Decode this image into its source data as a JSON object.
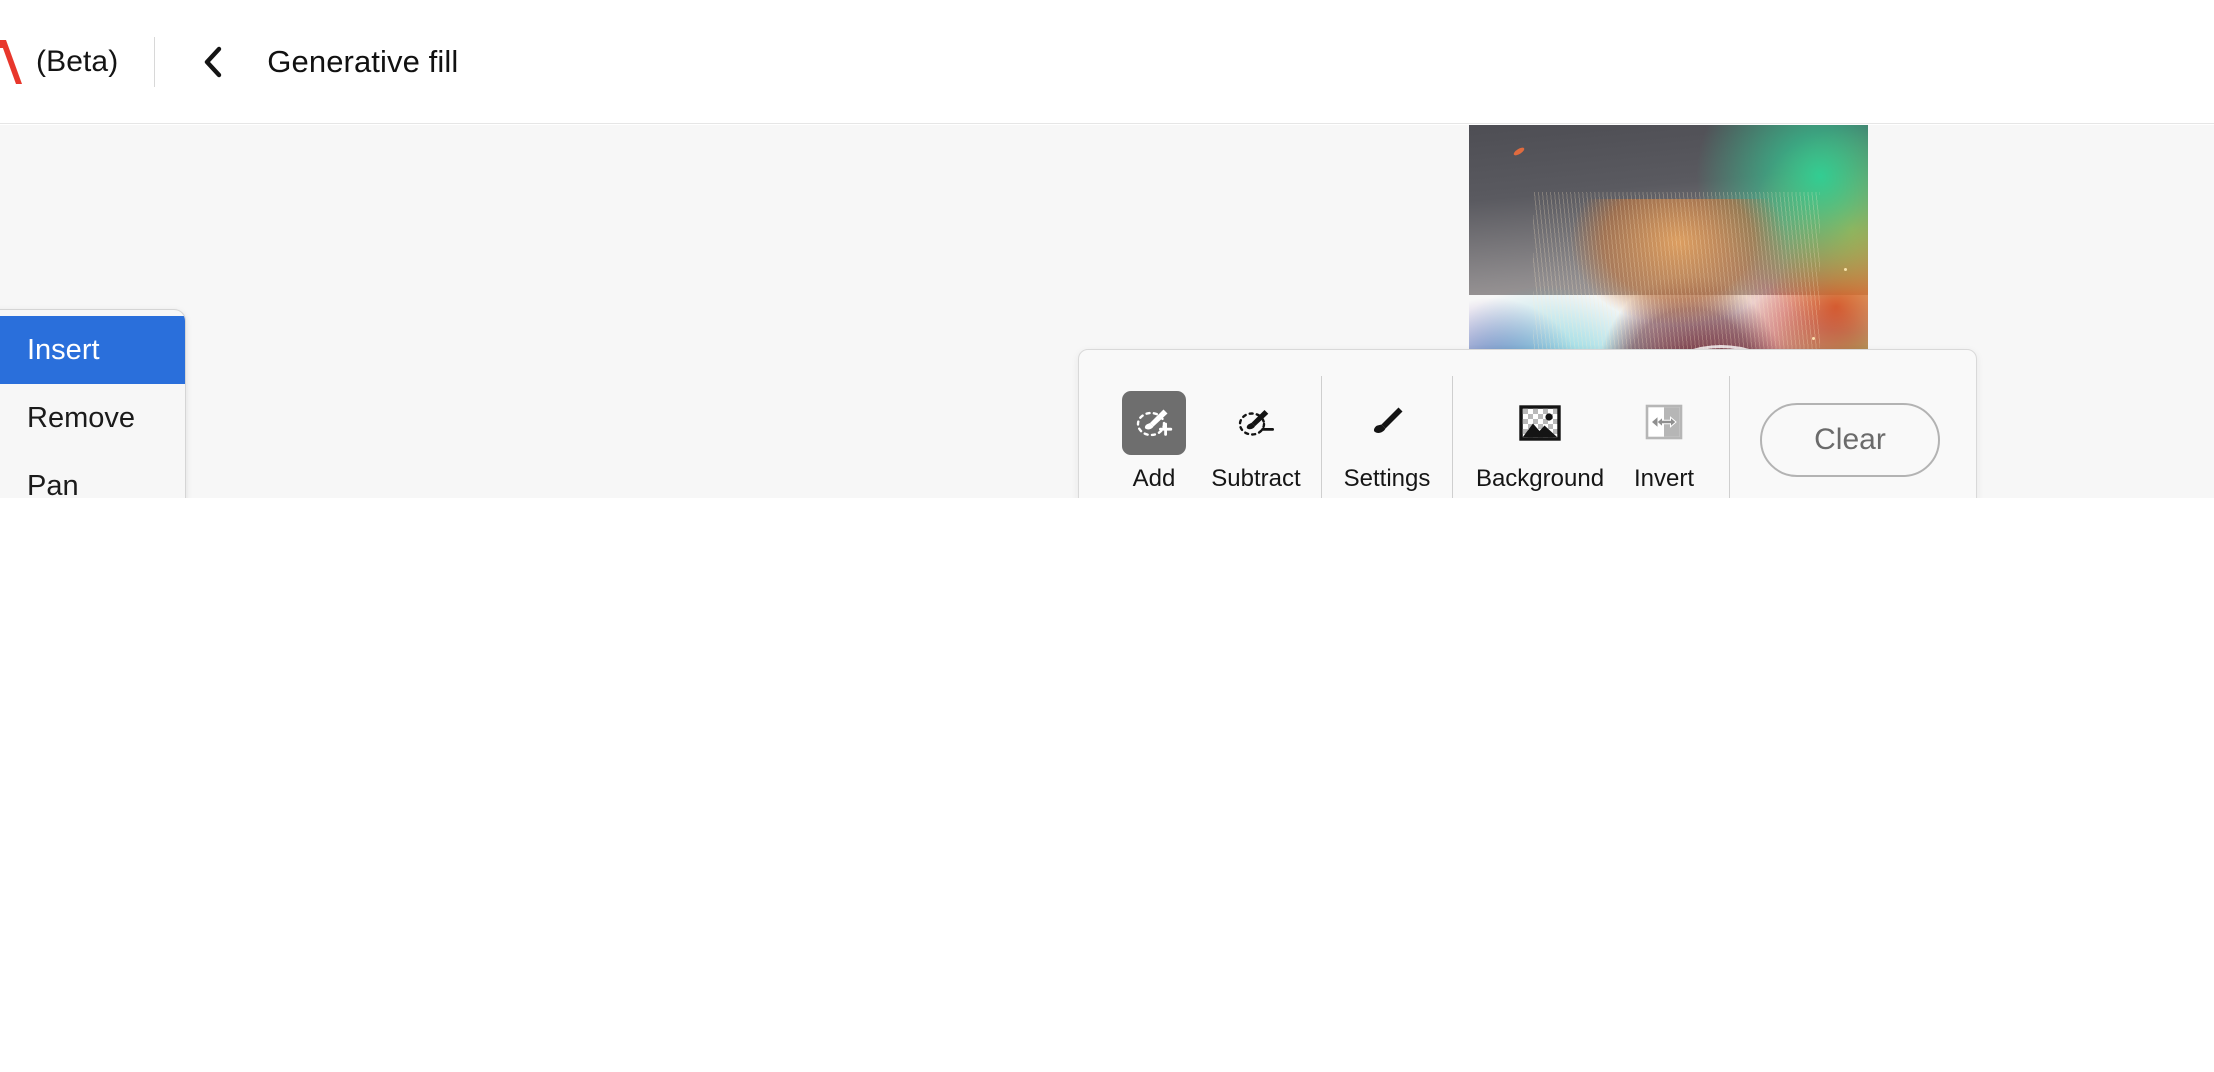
{
  "header": {
    "logo_icon": "adobe-logo-icon",
    "beta_label": "(Beta)",
    "back_icon": "chevron-left-icon",
    "title": "Generative fill"
  },
  "tool_panel": {
    "items": [
      {
        "label": "Insert",
        "icon": "sparkle-selection-icon",
        "active": true
      },
      {
        "label": "Remove",
        "icon": "healing-brush-icon",
        "active": false
      },
      {
        "label": "Pan",
        "icon": "hand-icon",
        "active": false
      }
    ]
  },
  "options_bar": {
    "add": {
      "label": "Add",
      "icon": "brush-add-icon",
      "selected": true
    },
    "subtract": {
      "label": "Subtract",
      "icon": "brush-subtract-icon",
      "selected": false
    },
    "settings": {
      "label": "Settings",
      "icon": "brush-icon"
    },
    "background": {
      "label": "Background",
      "icon": "image-transparent-icon"
    },
    "invert": {
      "label": "Invert",
      "icon": "invert-selection-icon",
      "disabled": true
    },
    "clear": {
      "label": "Clear"
    }
  },
  "canvas": {
    "artwork_alt": "colorful nebula portrait artwork"
  },
  "colors": {
    "accent_blue": "#2a6fdb",
    "adobe_red": "#e8372c",
    "active_gray": "#6e6e6e",
    "canvas_bg": "#f7f7f7",
    "panel_bg": "#f9f9f9",
    "border": "#d9d9d9"
  }
}
